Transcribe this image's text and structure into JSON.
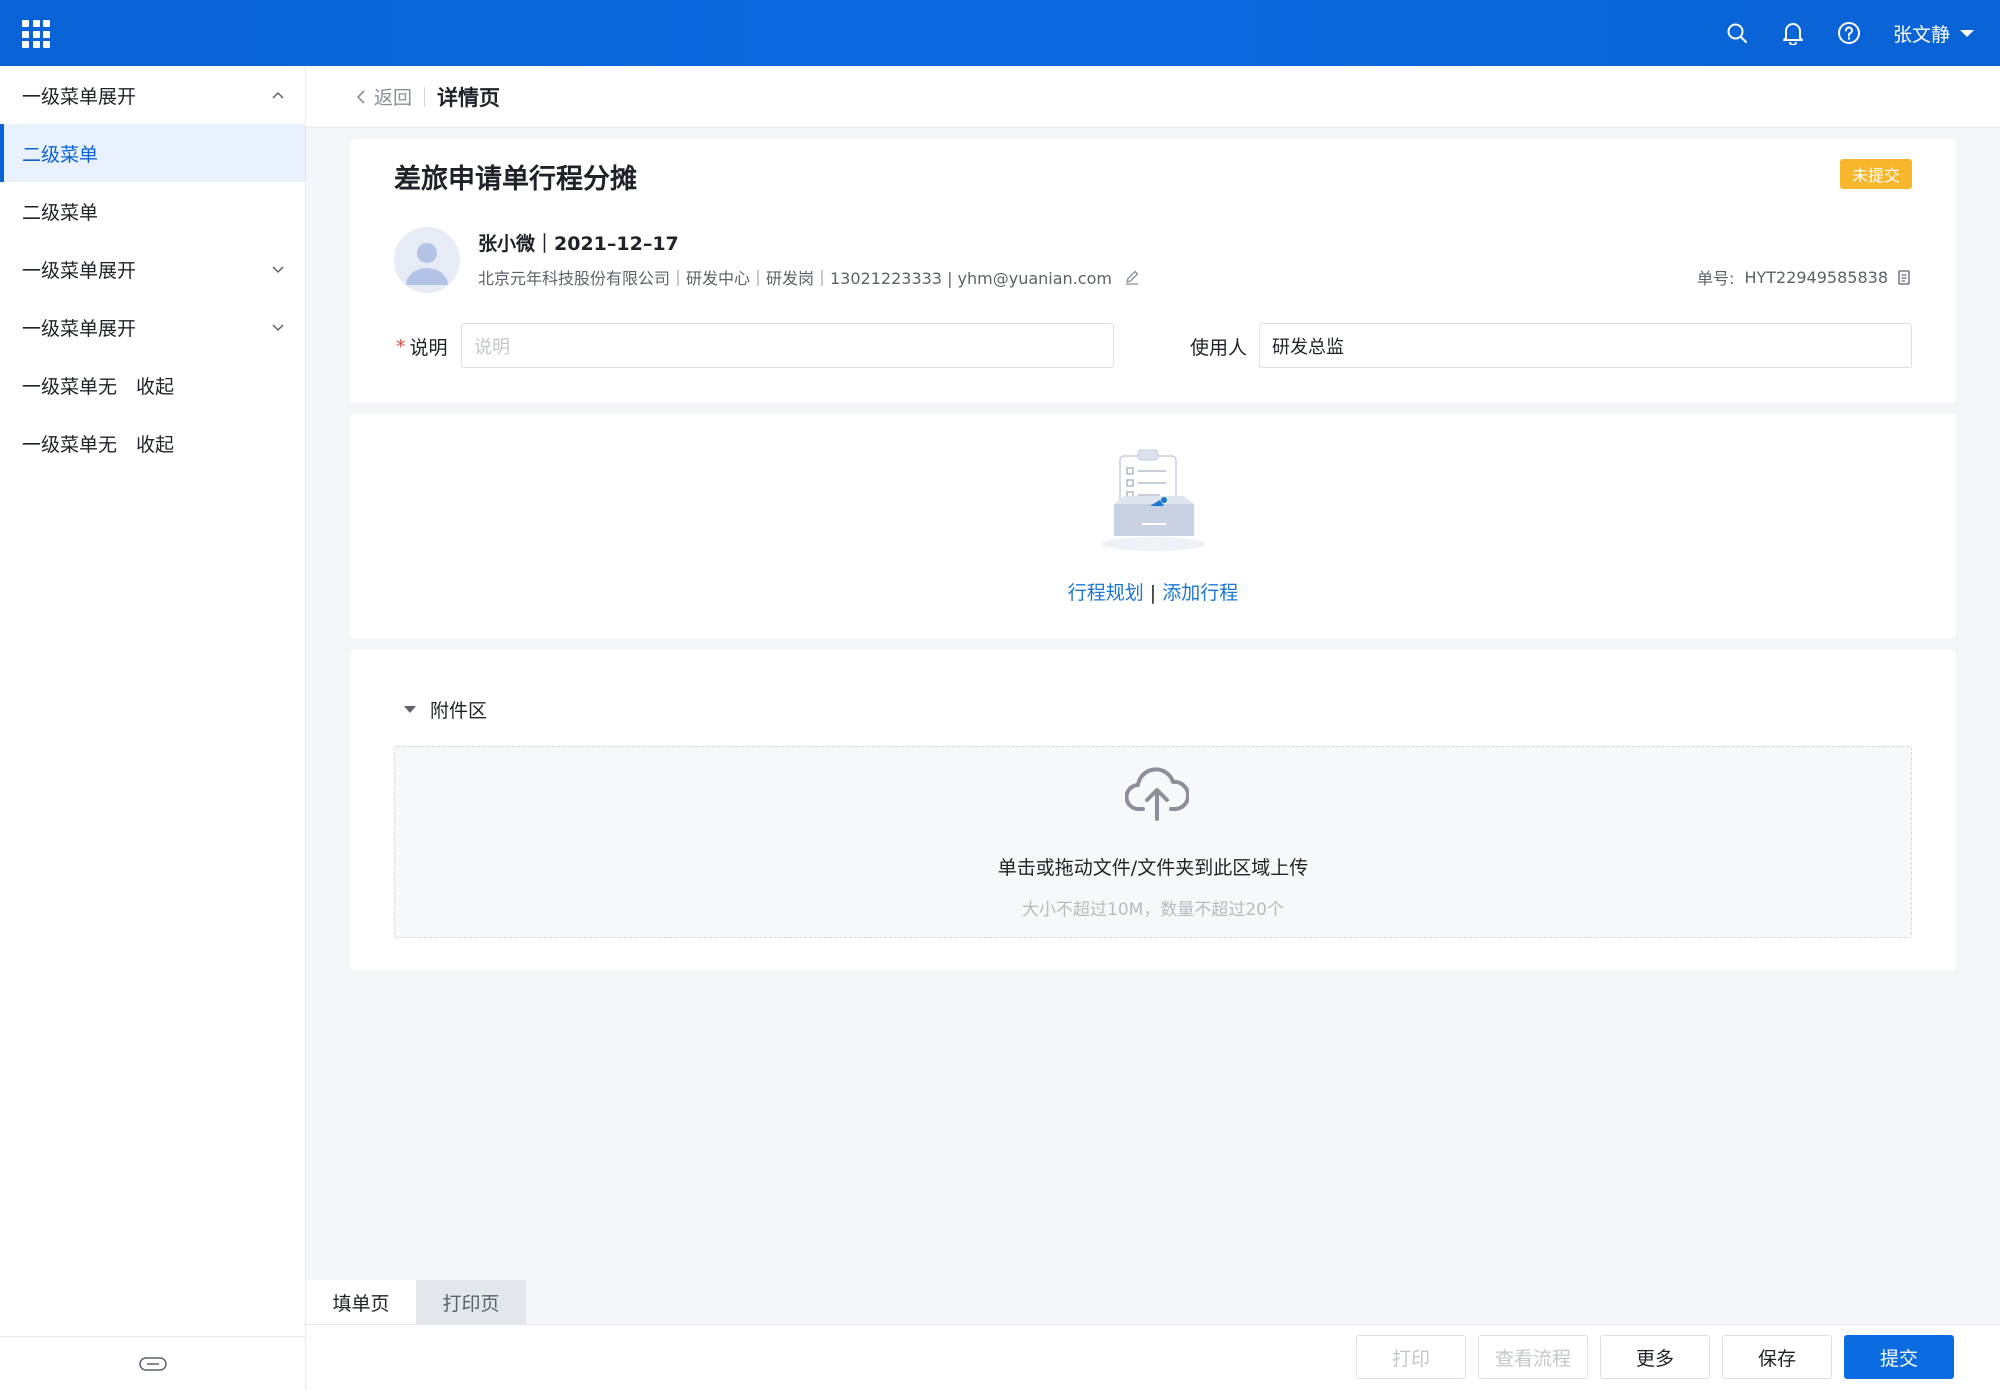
{
  "topbar": {
    "user_name": "张文静",
    "icons": [
      "search-icon",
      "bell-icon",
      "help-icon"
    ]
  },
  "sidebar": {
    "items": [
      {
        "label": "一级菜单展开",
        "state": "expanded"
      },
      {
        "label": "二级菜单",
        "state": "active"
      },
      {
        "label": "二级菜单",
        "state": "normal"
      },
      {
        "label": "一级菜单展开",
        "state": "collapsed"
      },
      {
        "label": "一级菜单展开",
        "state": "collapsed"
      },
      {
        "label": "一级菜单无　收起",
        "state": "leaf"
      },
      {
        "label": "一级菜单无　收起",
        "state": "leaf"
      }
    ]
  },
  "breadcrumb": {
    "back_label": "返回",
    "title": "详情页"
  },
  "document": {
    "title": "差旅申请单行程分摊",
    "status": "未提交",
    "applicant_line": "张小微｜2021–12–17",
    "applicant_info": "北京元年科技股份有限公司｜研发中心｜研发岗｜13021223333 | yhm@yuanian.com",
    "order_no_label": "单号:",
    "order_no": "HYT22949585838"
  },
  "form": {
    "desc_label": "说明",
    "desc_placeholder": "说明",
    "user_label": "使用人",
    "user_value": "研发总监"
  },
  "itinerary": {
    "plan_link": "行程规划",
    "separator": "|",
    "add_link": "添加行程"
  },
  "attachment": {
    "title": "附件区",
    "drop_text": "单击或拖动文件/文件夹到此区域上传",
    "hint": "大小不超过10M，数量不超过20个"
  },
  "tabs": {
    "fill": "填单页",
    "print": "打印页"
  },
  "actions": {
    "print": "打印",
    "flow": "查看流程",
    "more": "更多",
    "save": "保存",
    "submit": "提交"
  },
  "colors": {
    "brand": "#0a63d6",
    "warning": "#f8b62d",
    "link": "#1b77d0",
    "required": "#e5443b"
  }
}
